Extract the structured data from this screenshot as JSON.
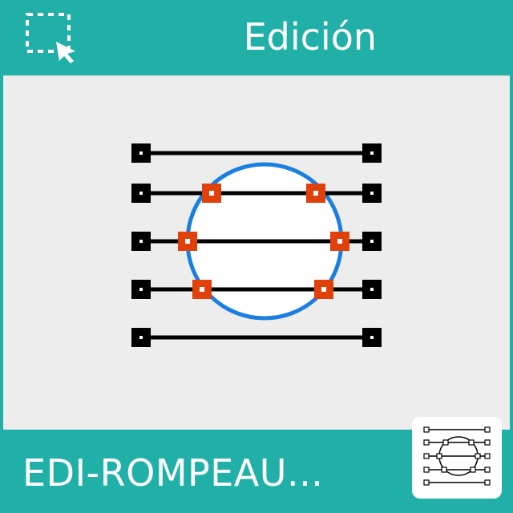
{
  "header": {
    "category": "Edición",
    "select_icon": "selection-cursor-icon"
  },
  "main": {
    "icon": "break-lines-circle-icon"
  },
  "footer": {
    "command_name": "EDI-ROMPEAU...",
    "thumbnail_icon": "break-lines-circle-thumbnail-icon"
  },
  "colors": {
    "teal": "#20b0a8",
    "canvas": "#ededed",
    "line": "#000000",
    "break_point": "#e0400a",
    "circle": "#1a7fe0"
  }
}
